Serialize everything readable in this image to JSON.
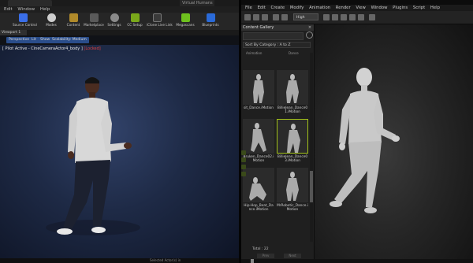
{
  "left_app": {
    "title_tab": "Virtual Humans",
    "menu": [
      "Edit",
      "Window",
      "Help"
    ],
    "toolbar": [
      {
        "label": "Source Control",
        "icon": "source-control-icon",
        "color": "#3a6ee8"
      },
      {
        "label": "Modes",
        "icon": "modes-icon",
        "color": "#cfcfcf"
      },
      {
        "label": "Content",
        "icon": "content-icon",
        "color": "#b08a2a"
      },
      {
        "label": "Marketplace",
        "icon": "marketplace-icon",
        "color": "#5a5a5a"
      },
      {
        "label": "Settings",
        "icon": "settings-icon",
        "color": "#8a8a8a"
      },
      {
        "label": "CC Setup",
        "icon": "cc-setup-icon",
        "color": "#7aa81a"
      },
      {
        "label": "iClone Live Link",
        "icon": "live-link-icon",
        "color": "#3a3a3a"
      },
      {
        "label": "Megascans",
        "icon": "megascans-icon",
        "color": "#6ec11e"
      },
      {
        "label": "Blueprints",
        "icon": "blueprints-icon",
        "color": "#2a6ad8"
      }
    ],
    "viewport_tab": "Viewport 1",
    "viewport_buttons": [
      "Perspective",
      "Lit",
      "Show",
      "Scalability: Medium"
    ],
    "pilot_text": "[ Pilot Active - CineCameraActor4_body ]",
    "pilot_locked": "[Locked]",
    "status_text": "Selected Actor(s) in"
  },
  "right_app": {
    "menu": [
      "File",
      "Edit",
      "Create",
      "Modify",
      "Animation",
      "Render",
      "View",
      "Window",
      "Plugins",
      "Script",
      "Help"
    ],
    "quality": "High",
    "gallery": {
      "title": "Content Gallery",
      "sort_label": "Sort By Category : A to Z",
      "columns": [
        "Animation",
        "Dance"
      ],
      "items": [
        {
          "caption": "sit_Dance.iMotion",
          "selected": false
        },
        {
          "caption": "BillieJean_Dance01.iMotion",
          "selected": false
        },
        {
          "caption": "Bruken_Dance02.iMotion",
          "selected": false
        },
        {
          "caption": "BillieJean_Dance03.iMotion",
          "selected": true
        },
        {
          "caption": "Hip-Hop_Beat_Dance.iMotion",
          "selected": false
        },
        {
          "caption": "MrRobotic_Dance.iMotion",
          "selected": false
        }
      ],
      "pager": "Total : 22",
      "buttons": [
        "Prev",
        "Next"
      ]
    }
  },
  "colors": {
    "selection": "#a3c21a",
    "locked": "#e04040"
  }
}
